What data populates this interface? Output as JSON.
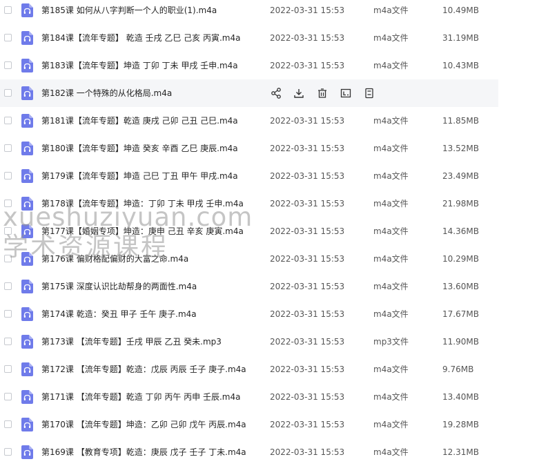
{
  "files": [
    {
      "name": "第185课 如何从八字判断一个人的职业(1).m4a",
      "date": "2022-03-31 15:53",
      "type": "m4a文件",
      "size": "10.49MB"
    },
    {
      "name": "第184课【流年专题】 乾造 壬戌 乙巳 己亥 丙寅.m4a",
      "date": "2022-03-31 15:53",
      "type": "m4a文件",
      "size": "31.19MB"
    },
    {
      "name": "第183课【流年专题】坤造 丁卯 丁未 甲戌 壬申.m4a",
      "date": "2022-03-31 15:53",
      "type": "m4a文件",
      "size": "10.43MB"
    },
    {
      "name": "第182课 一个特殊的从化格局.m4a",
      "date": "",
      "type": "",
      "size": ""
    },
    {
      "name": "第181课【流年专题】乾造 庚戌 己卯 己丑 己巳.m4a",
      "date": "2022-03-31 15:53",
      "type": "m4a文件",
      "size": "11.85MB"
    },
    {
      "name": "第180课【流年专题】坤造 癸亥 辛酉 乙巳 庚辰.m4a",
      "date": "2022-03-31 15:53",
      "type": "m4a文件",
      "size": "13.52MB"
    },
    {
      "name": "第179课【流年专题】坤造 己巳 丁丑 甲午 甲戌.m4a",
      "date": "2022-03-31 15:53",
      "type": "m4a文件",
      "size": "23.49MB"
    },
    {
      "name": "第178课【流年专题】坤造：丁卯 丁未 甲戌 壬申.m4a",
      "date": "2022-03-31 15:53",
      "type": "m4a文件",
      "size": "21.98MB"
    },
    {
      "name": "第177课【婚姻专项】坤造：庚申 己丑 辛亥 庚寅.m4a",
      "date": "2022-03-31 15:53",
      "type": "m4a文件",
      "size": "14.36MB"
    },
    {
      "name": "第176课 偏财格配偏财的大富之命.m4a",
      "date": "2022-03-31 15:53",
      "type": "m4a文件",
      "size": "10.29MB"
    },
    {
      "name": "第175课 深度认识比劫帮身的两面性.m4a",
      "date": "2022-03-31 15:53",
      "type": "m4a文件",
      "size": "13.60MB"
    },
    {
      "name": "第174课 乾造：癸丑 甲子 壬午 庚子.m4a",
      "date": "2022-03-31 15:53",
      "type": "m4a文件",
      "size": "17.67MB"
    },
    {
      "name": "第173课 【流年专题】壬戌 甲辰 乙丑 癸未.mp3",
      "date": "2022-03-31 15:53",
      "type": "mp3文件",
      "size": "11.90MB"
    },
    {
      "name": "第172课 【流年专题】乾造：戊辰 丙辰 壬子 庚子.m4a",
      "date": "2022-03-31 15:53",
      "type": "m4a文件",
      "size": "9.76MB"
    },
    {
      "name": "第171课 【流年专题】乾造 丁卯 丙午 丙申 壬辰.m4a",
      "date": "2022-03-31 15:53",
      "type": "m4a文件",
      "size": "13.40MB"
    },
    {
      "name": "第170课 【流年专题】坤造：乙卯 己卯 戊午 丙辰.m4a",
      "date": "2022-03-31 15:53",
      "type": "m4a文件",
      "size": "19.28MB"
    },
    {
      "name": "第169课 【教育专项】乾造：庚辰 戊子 壬子 丁未.m4a",
      "date": "2022-03-31 15:53",
      "type": "m4a文件",
      "size": "12.31MB"
    }
  ],
  "hovered_row": 3,
  "row_actions": [
    "share-icon",
    "download-icon",
    "delete-icon",
    "rename-icon",
    "more-icon"
  ],
  "watermark": {
    "line1": "xueshuziyuan.com",
    "line2": "学术资源课程"
  },
  "colors": {
    "icon_bg": "#6f7bea",
    "hover_bg": "#f5f6f8",
    "text": "#252525",
    "meta_text": "#555555"
  }
}
